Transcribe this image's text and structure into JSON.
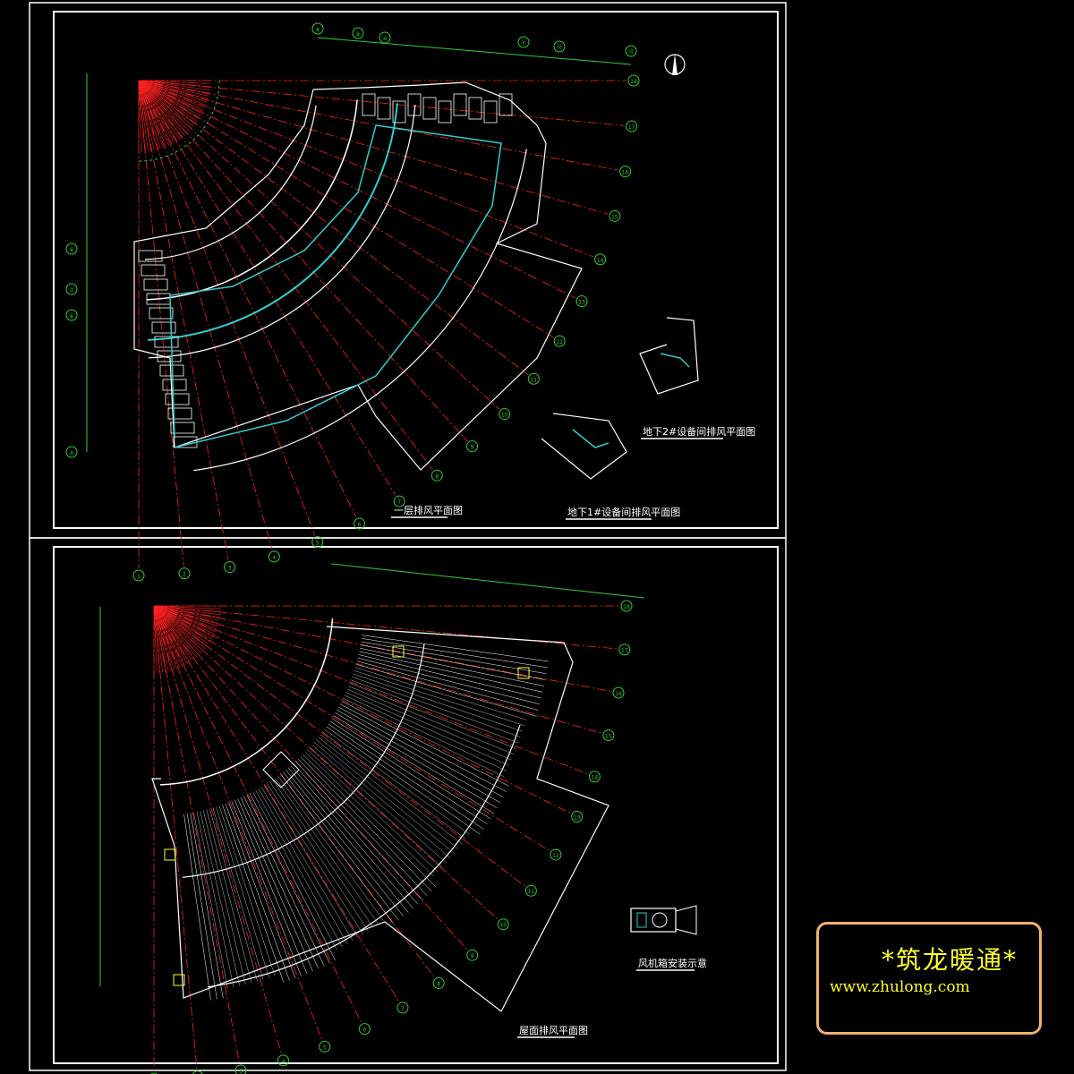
{
  "sheet1": {
    "plan_title": "一层排风平面图",
    "detail_b1_title": "地下1#设备间排风平面图",
    "detail_b2_title": "地下2#设备间排风平面图",
    "top_axis_labels": [
      "⑧",
      "⑨",
      "⑩",
      "⑪",
      "⑫",
      "⑬",
      "⑭",
      "⑮",
      "⑯"
    ],
    "radial_axis_labels": [
      "18",
      "17",
      "16",
      "15",
      "14",
      "13",
      "12",
      "11",
      "10",
      "9",
      "8",
      "7",
      "6",
      "5",
      "4",
      "3",
      "2",
      "1"
    ]
  },
  "sheet2": {
    "plan_title": "屋面排风平面图",
    "detail_title": "风机箱安装示意",
    "radial_axis_labels": [
      "18",
      "17",
      "16",
      "15",
      "14",
      "13",
      "12",
      "11",
      "10",
      "9",
      "8",
      "7",
      "6",
      "5",
      "4",
      "3",
      "2",
      "1"
    ]
  },
  "watermark": {
    "title": "*筑龙暖通*",
    "url": "www.zhulong.com"
  },
  "colors": {
    "background": "#000000",
    "frame": "#ffffff",
    "axis": "#ff2222",
    "dim": "#33cc33",
    "duct": "#33cccc",
    "watermark_text": "#ffff33",
    "watermark_border": "#f0b070"
  }
}
